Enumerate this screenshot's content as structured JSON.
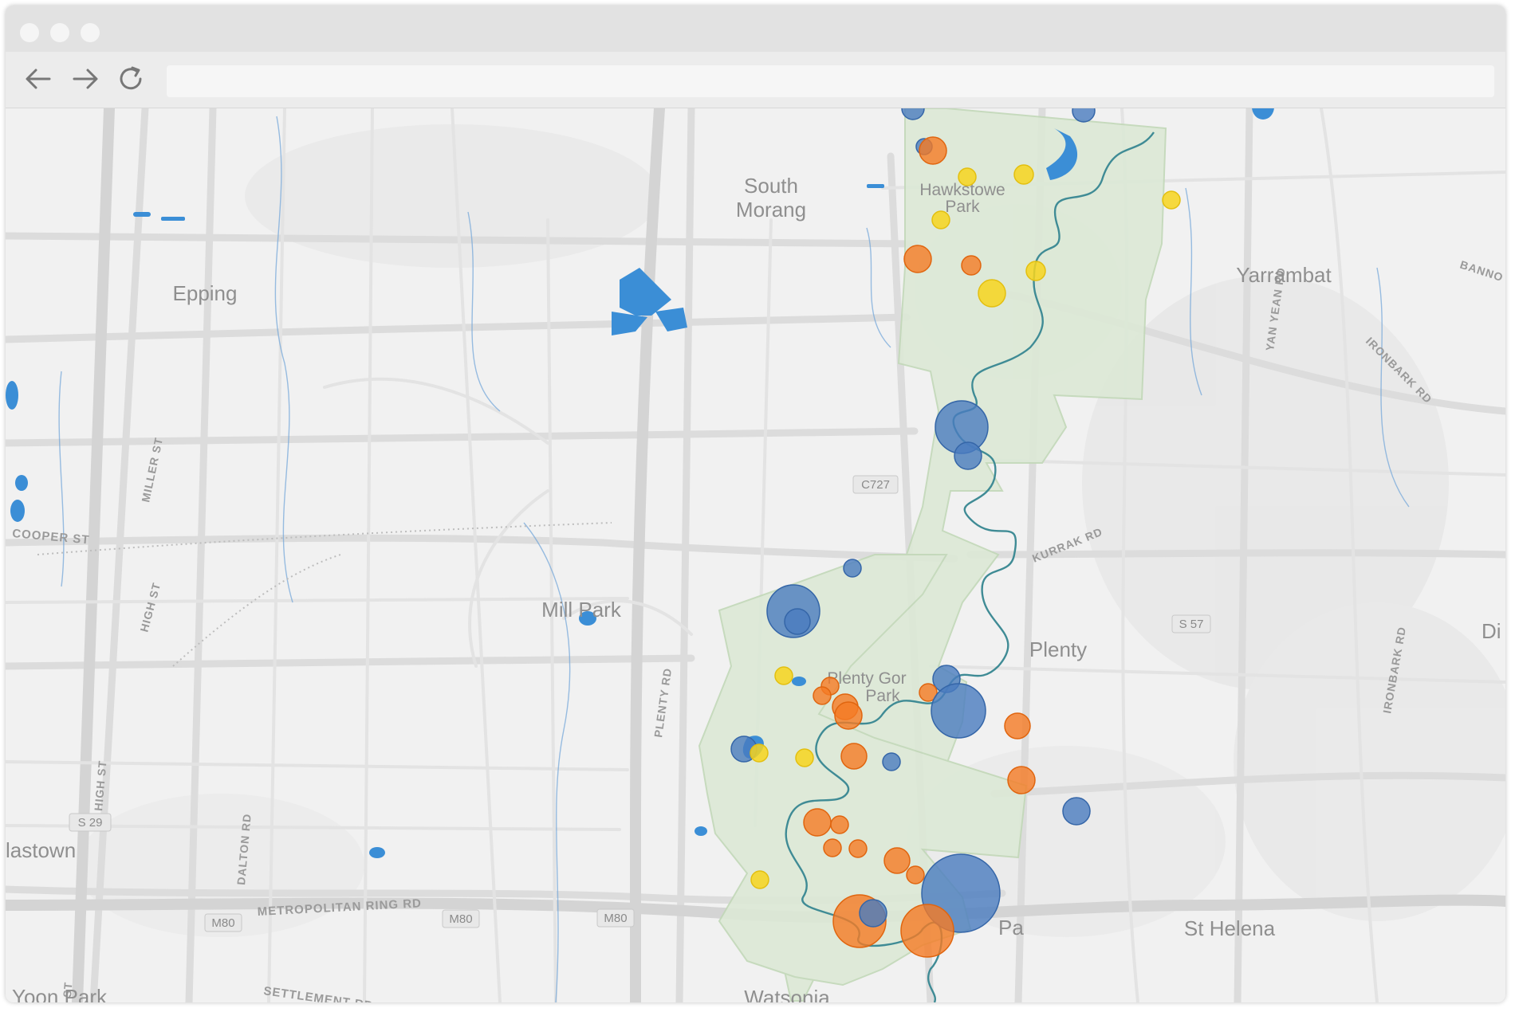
{
  "browser": {
    "url": "",
    "icons": [
      "back-arrow-icon",
      "forward-arrow-icon",
      "reload-icon"
    ]
  },
  "map": {
    "colors": {
      "background": "#f1f1f1",
      "road": "#dadada",
      "road_major": "#d2d2d2",
      "water": "#3b8ed6",
      "park_fill": "#dbe9d6",
      "park_stroke": "#bcd4b4",
      "river": "#3f8b95",
      "blue": "#4a7cbf",
      "orange": "#f57a24",
      "yellow": "#f7d51e"
    },
    "places": {
      "south_morang_1": "South",
      "south_morang_2": "Morang",
      "hawkstowe_1": "Hawkstowe",
      "hawkstowe_2": "Park",
      "epping": "Epping",
      "yarrambat": "Yarrambat",
      "mill_park": "Mill Park",
      "plenty": "Plenty",
      "plenty_gorge_1": "Plenty Gor",
      "plenty_gorge_2": "Park",
      "lalor": "lastown",
      "st_helena": "St Helena",
      "watsonia": "Watsonia",
      "bundoora": "Pa",
      "kingsbury": "Yoon Park",
      "di": "Di"
    },
    "roads": {
      "cooper_st": "COOPER ST",
      "miller_st": "MILLER ST",
      "high_st_1": "HIGH ST",
      "high_st_2": "HIGH ST",
      "high_st_3": "HIGH ST",
      "dalton_rd": "DALTON RD",
      "plenty_rd": "PLENTY RD",
      "yan_yean_rd": "YAN YEAN RD",
      "ironbark_rd_1": "IRONBARK RD",
      "ironbark_rd_2": "IRONBARK RD",
      "kurrak_rd": "KURRAK RD",
      "metropolitan_ring_rd": "METROPOLITAN RING RD",
      "settlement_rd": "SETTLEMENT RD",
      "bannons": "BANNO"
    },
    "shields": {
      "c727": "C727",
      "s57": "S 57",
      "s29": "S 29",
      "m80_1": "M80",
      "m80_2": "M80",
      "m80_3": "M80"
    },
    "markers": [
      {
        "color": "blue",
        "size": 14
      },
      {
        "color": "blue",
        "size": 14
      },
      {
        "color": "blue",
        "size": 10
      },
      {
        "color": "orange",
        "size": 17
      },
      {
        "color": "yellow",
        "size": 11
      },
      {
        "color": "yellow",
        "size": 12
      },
      {
        "color": "yellow",
        "size": 11
      },
      {
        "color": "yellow",
        "size": 11
      },
      {
        "color": "orange",
        "size": 17
      },
      {
        "color": "orange",
        "size": 12
      },
      {
        "color": "yellow",
        "size": 12
      },
      {
        "color": "yellow",
        "size": 17
      },
      {
        "color": "blue",
        "size": 33
      },
      {
        "color": "blue",
        "size": 17
      },
      {
        "color": "blue",
        "size": 11
      },
      {
        "color": "blue",
        "size": 33
      },
      {
        "color": "blue",
        "size": 16
      },
      {
        "color": "yellow",
        "size": 11
      },
      {
        "color": "orange",
        "size": 11
      },
      {
        "color": "orange",
        "size": 11
      },
      {
        "color": "blue",
        "size": 17
      },
      {
        "color": "orange",
        "size": 16
      },
      {
        "color": "orange",
        "size": 17
      },
      {
        "color": "orange",
        "size": 11
      },
      {
        "color": "blue",
        "size": 34
      },
      {
        "color": "orange",
        "size": 16
      },
      {
        "color": "blue",
        "size": 16
      },
      {
        "color": "yellow",
        "size": 11
      },
      {
        "color": "yellow",
        "size": 11
      },
      {
        "color": "orange",
        "size": 16
      },
      {
        "color": "blue",
        "size": 11
      },
      {
        "color": "orange",
        "size": 17
      },
      {
        "color": "blue",
        "size": 17
      },
      {
        "color": "orange",
        "size": 17
      },
      {
        "color": "orange",
        "size": 11
      },
      {
        "color": "orange",
        "size": 11
      },
      {
        "color": "orange",
        "size": 11
      },
      {
        "color": "orange",
        "size": 16
      },
      {
        "color": "orange",
        "size": 11
      },
      {
        "color": "yellow",
        "size": 11
      },
      {
        "color": "blue",
        "size": 49
      },
      {
        "color": "orange",
        "size": 33
      },
      {
        "color": "blue",
        "size": 17
      },
      {
        "color": "orange",
        "size": 33
      }
    ]
  }
}
